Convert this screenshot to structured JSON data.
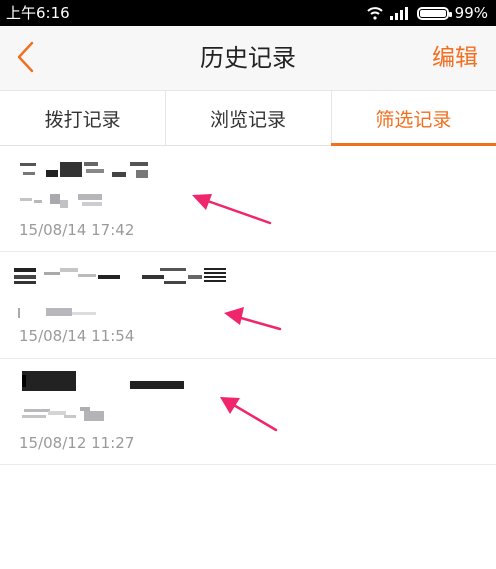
{
  "status_bar": {
    "time": "上午6:16",
    "battery": "99%"
  },
  "header": {
    "title": "历史记录",
    "edit_label": "编辑"
  },
  "tabs": [
    {
      "label": "拨打记录",
      "active": false
    },
    {
      "label": "浏览记录",
      "active": false
    },
    {
      "label": "筛选记录",
      "active": true
    }
  ],
  "records": [
    {
      "time": "15/08/14 17:42"
    },
    {
      "time": "15/08/14 11:54"
    },
    {
      "time": "15/08/12 11:27"
    }
  ],
  "colors": {
    "accent": "#f26f1f",
    "annotation_arrow": "#f0266c"
  }
}
